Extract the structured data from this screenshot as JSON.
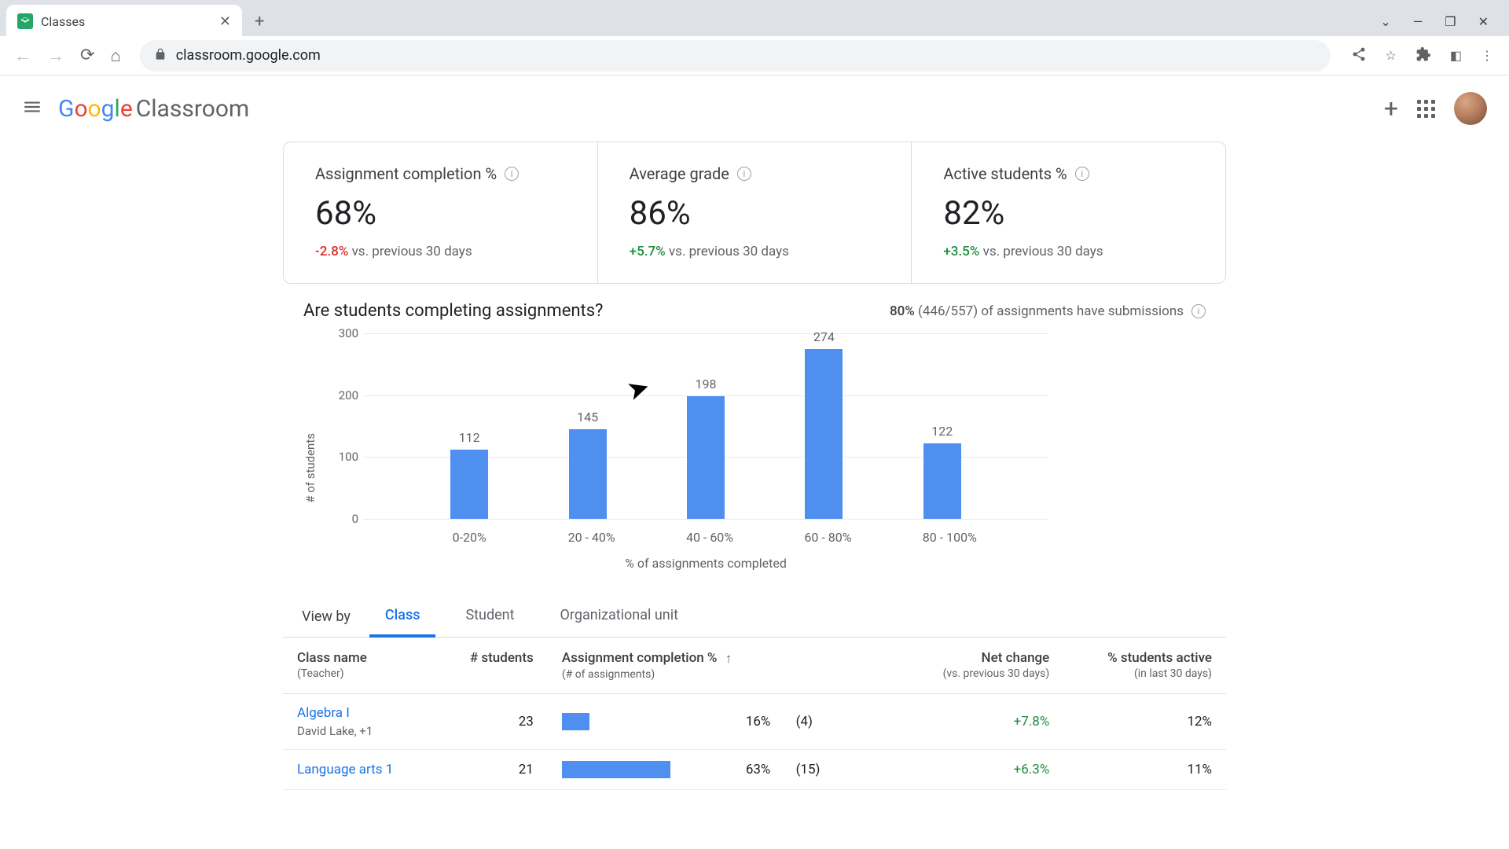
{
  "browser": {
    "tab_title": "Classes",
    "url": "classroom.google.com"
  },
  "app": {
    "logo_brand": "Google",
    "logo_product": "Classroom"
  },
  "stats": [
    {
      "title": "Assignment completion %",
      "value": "68%",
      "delta": "-2.8%",
      "delta_dir": "neg",
      "delta_sub": "vs. previous 30 days"
    },
    {
      "title": "Average grade",
      "value": "86%",
      "delta": "+5.7%",
      "delta_dir": "pos",
      "delta_sub": "vs. previous 30 days"
    },
    {
      "title": "Active students  %",
      "value": "82%",
      "delta": "+3.5%",
      "delta_dir": "pos",
      "delta_sub": "vs. previous 30 days"
    }
  ],
  "chart_section": {
    "question": "Are students completing assignments?",
    "sub_pct": "80%",
    "sub_text": "(446/557) of assignments have submissions"
  },
  "chart_data": {
    "type": "bar",
    "categories": [
      "0-20%",
      "20 - 40%",
      "40 - 60%",
      "60 - 80%",
      "80 - 100%"
    ],
    "values": [
      112,
      145,
      198,
      274,
      122
    ],
    "xlabel": "% of assignments completed",
    "ylabel": "# of students",
    "ylim": [
      0,
      300
    ],
    "yticks": [
      0,
      100,
      200,
      300
    ]
  },
  "view_by": {
    "label": "View by",
    "tabs": [
      "Class",
      "Student",
      "Organizational unit"
    ],
    "active": 0
  },
  "table": {
    "headers": {
      "class": "Class name",
      "class_sub": "(Teacher)",
      "students": "# students",
      "completion": "Assignment completion %",
      "completion_sub": "(# of assignments)",
      "netchange": "Net change",
      "netchange_sub": "(vs. previous 30 days)",
      "active": "% students active",
      "active_sub": "(in last 30 days)"
    },
    "rows": [
      {
        "class": "Algebra I",
        "teacher": "David Lake, +1",
        "students": "23",
        "pct": "16%",
        "count": "(4)",
        "bar_pct": 16,
        "net": "+7.8%",
        "active": "12%"
      },
      {
        "class": "Language arts 1",
        "teacher": "",
        "students": "21",
        "pct": "63%",
        "count": "(15)",
        "bar_pct": 63,
        "net": "+6.3%",
        "active": "11%"
      }
    ]
  }
}
